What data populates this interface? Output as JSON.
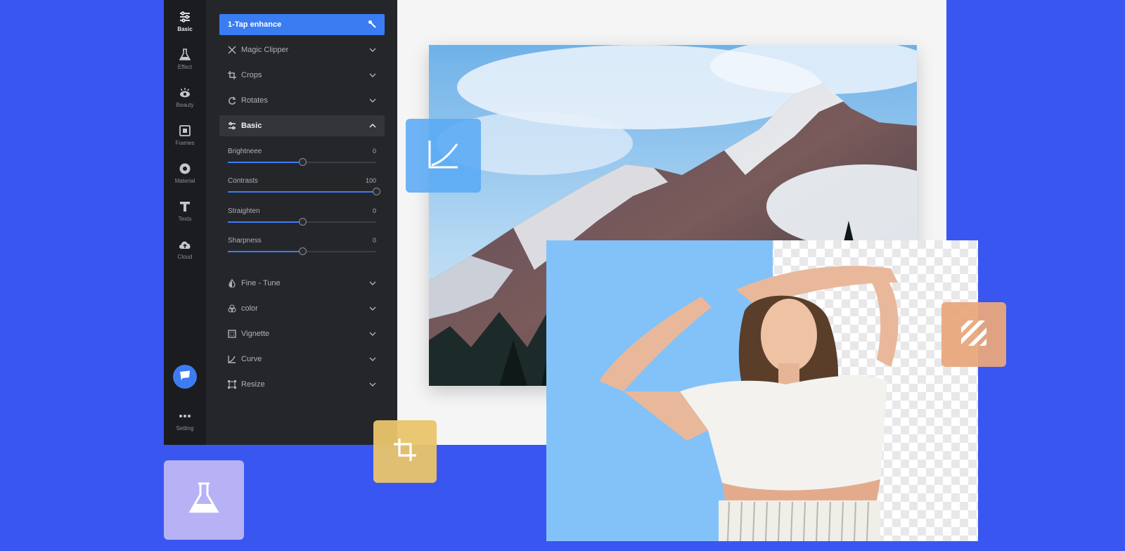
{
  "rail": {
    "items": [
      {
        "label": "Basic",
        "icon": "sliders-icon"
      },
      {
        "label": "Effect",
        "icon": "flask-icon"
      },
      {
        "label": "Beauty",
        "icon": "eye-icon"
      },
      {
        "label": "Frames",
        "icon": "frame-icon"
      },
      {
        "label": "Material",
        "icon": "material-icon"
      },
      {
        "label": "Texts",
        "icon": "text-icon"
      },
      {
        "label": "Cloud",
        "icon": "cloud-icon"
      }
    ],
    "setting_label": "Setting"
  },
  "panel": {
    "enhance_label": "1-Tap enhance",
    "top_sections": [
      {
        "label": "Magic Clipper",
        "icon": "scissors-icon"
      },
      {
        "label": "Crops",
        "icon": "crop-icon"
      },
      {
        "label": "Rotates",
        "icon": "rotate-icon"
      }
    ],
    "open_section": {
      "label": "Basic",
      "icon": "sliders-icon"
    },
    "sliders": [
      {
        "label": "Brightneee",
        "value": "0",
        "fraction": 0.5
      },
      {
        "label": "Contrasts",
        "value": "100",
        "fraction": 1.0
      },
      {
        "label": "Straighten",
        "value": "0",
        "fraction": 0.5
      },
      {
        "label": "Sharpness",
        "value": "0",
        "fraction": 0.5
      }
    ],
    "bottom_sections": [
      {
        "label": "Fine - Tune",
        "icon": "droplet-icon"
      },
      {
        "label": "color",
        "icon": "color-circles-icon"
      },
      {
        "label": "Vignette",
        "icon": "vignette-icon"
      },
      {
        "label": "Curve",
        "icon": "curve-icon"
      },
      {
        "label": "Resize",
        "icon": "resize-icon"
      }
    ]
  },
  "colors": {
    "background": "#3a56f0",
    "accent": "#3a7df3",
    "rail": "#1b1c1f",
    "panel": "#25262a",
    "tile_curve": "#5aaaf5",
    "tile_crop": "#e9c46a",
    "tile_flask": "#b6b2f5",
    "tile_stripes": "#e8a87c"
  }
}
